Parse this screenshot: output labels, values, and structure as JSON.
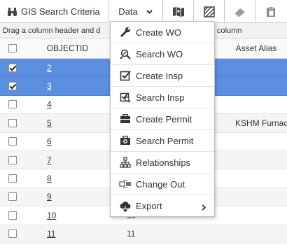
{
  "toolbar": {
    "search_label": "GIS Search Criteria",
    "data_label": "Data"
  },
  "groupbar": {
    "text_left": "Drag a column header and d",
    "text_right": "column"
  },
  "grid": {
    "columns": {
      "objectid": "OBJECTID",
      "alias": "Asset Alias"
    },
    "rows": [
      {
        "id": "2",
        "num": "",
        "alias": "",
        "checked": true,
        "selected": true
      },
      {
        "id": "3",
        "num": "",
        "alias": "",
        "checked": true,
        "selected": true
      },
      {
        "id": "4",
        "num": "",
        "alias": "",
        "checked": false,
        "selected": false
      },
      {
        "id": "5",
        "num": "",
        "alias": "KSHM Furnac",
        "checked": false,
        "selected": false
      },
      {
        "id": "6",
        "num": "",
        "alias": "",
        "checked": false,
        "selected": false
      },
      {
        "id": "7",
        "num": "",
        "alias": "",
        "checked": false,
        "selected": false
      },
      {
        "id": "8",
        "num": "",
        "alias": "",
        "checked": false,
        "selected": false
      },
      {
        "id": "9",
        "num": "",
        "alias": "",
        "checked": false,
        "selected": false
      },
      {
        "id": "10",
        "num": "10",
        "alias": "",
        "checked": false,
        "selected": false
      },
      {
        "id": "11",
        "num": "11",
        "alias": "",
        "checked": false,
        "selected": false
      }
    ]
  },
  "menu": {
    "items": [
      {
        "label": "Create WO",
        "icon": "wrench-icon"
      },
      {
        "label": "Search WO",
        "icon": "search-wrench-icon"
      },
      {
        "label": "Create Insp",
        "icon": "checkbox-icon"
      },
      {
        "label": "Search Insp",
        "icon": "search-checkbox-icon"
      },
      {
        "label": "Create Permit",
        "icon": "briefcase-icon"
      },
      {
        "label": "Search Permit",
        "icon": "search-briefcase-icon"
      },
      {
        "label": "Relationships",
        "icon": "hierarchy-icon"
      },
      {
        "label": "Change Out",
        "icon": "change-out-icon"
      },
      {
        "label": "Export",
        "icon": "export-icon"
      }
    ]
  },
  "colors": {
    "selected_row": "#5b8fe0",
    "border": "#c8c8c8"
  }
}
